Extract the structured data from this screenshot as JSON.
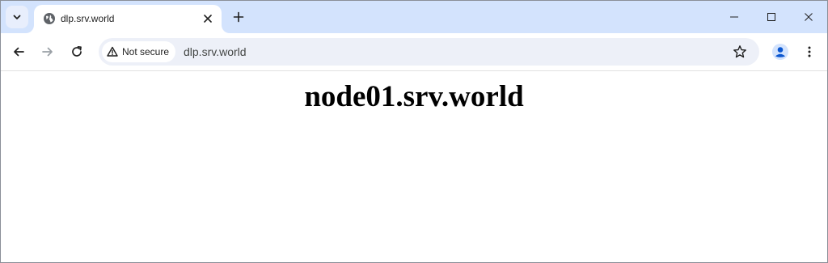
{
  "browser": {
    "tab": {
      "title": "dlp.srv.world"
    },
    "address_bar": {
      "security_label": "Not secure",
      "url": "dlp.srv.world"
    },
    "icons": {
      "tab_search": "chevron-down-icon",
      "favicon": "globe-icon",
      "tab_close": "close-icon",
      "new_tab": "plus-icon",
      "minimize": "minimize-icon",
      "maximize": "maximize-icon",
      "close_window": "close-icon",
      "back": "arrow-left-icon",
      "forward": "arrow-right-icon",
      "reload": "reload-icon",
      "security": "warning-triangle-icon",
      "bookmark": "star-icon",
      "profile": "person-icon",
      "menu": "kebab-menu-icon"
    },
    "colors": {
      "tabstrip": "#d3e3fd",
      "omnibox": "#edf0f8",
      "profile_accent": "#0b57d0"
    }
  },
  "page": {
    "heading": "node01.srv.world"
  }
}
